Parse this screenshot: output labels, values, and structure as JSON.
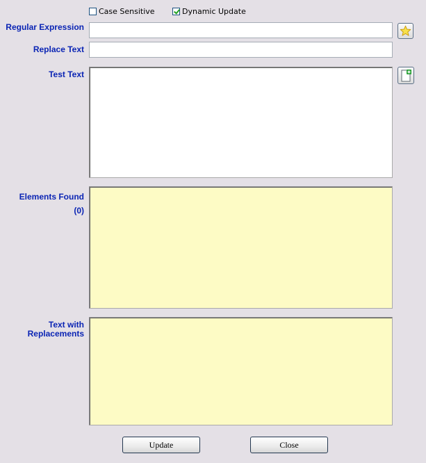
{
  "options": {
    "case_sensitive": {
      "label": "Case Sensitive",
      "checked": false
    },
    "dynamic_update": {
      "label": "Dynamic Update",
      "checked": true
    }
  },
  "labels": {
    "regular_expression": "Regular Expression",
    "replace_text": "Replace Text",
    "test_text": "Test Text",
    "elements_found": "Elements Found",
    "elements_count": "(0)",
    "text_with_replacements_line1": "Text with",
    "text_with_replacements_line2": "Replacements"
  },
  "inputs": {
    "regular_expression_value": "",
    "replace_text_value": "",
    "test_text_value": "",
    "elements_found_value": "",
    "text_with_replacements_value": ""
  },
  "buttons": {
    "update": "Update",
    "close": "Close"
  },
  "icons": {
    "favorite": "star-icon",
    "new_document": "new-document-icon"
  },
  "colors": {
    "background": "#e4e0e6",
    "label_text": "#0a24b4",
    "result_area": "#fdfbc5"
  }
}
